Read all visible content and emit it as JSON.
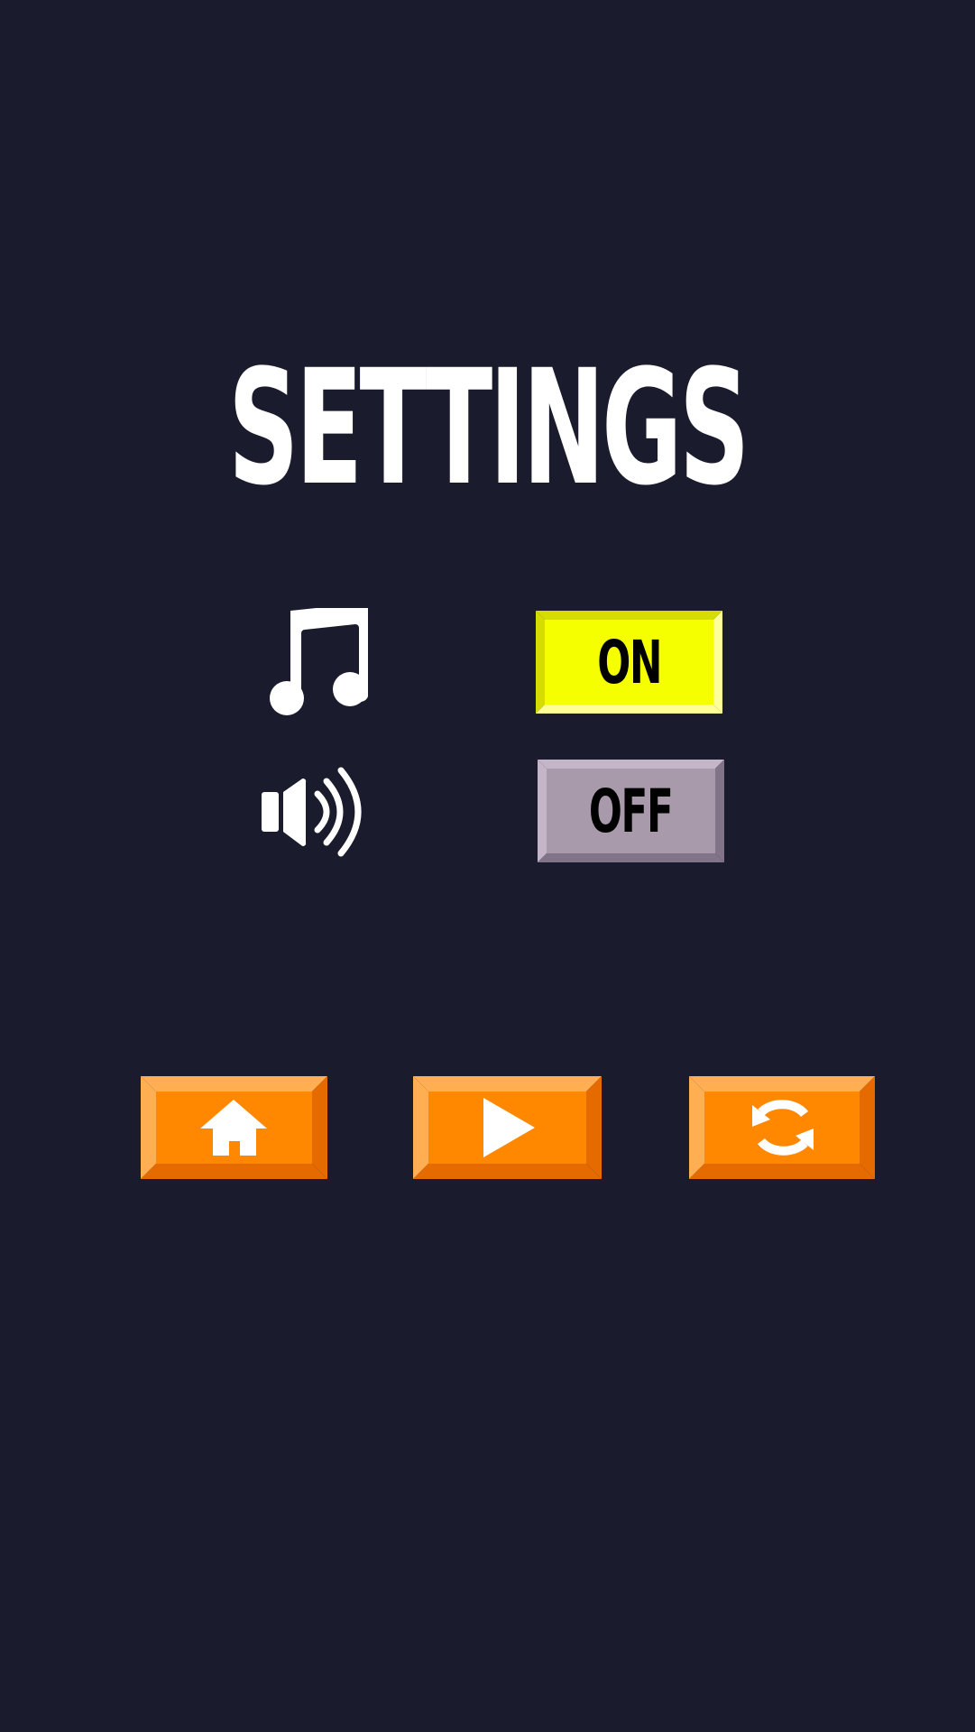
{
  "screen": {
    "title": "SETTINGS"
  },
  "settings": {
    "music": {
      "icon": "music-note-icon",
      "state_label": "ON",
      "colors": {
        "face": "#f5ff00",
        "top": "#d6dc00",
        "bottom": "#ffff99"
      }
    },
    "sound": {
      "icon": "speaker-icon",
      "state_label": "OFF",
      "colors": {
        "face": "#a89aaa",
        "top": "#c4b6c8",
        "bottom": "#827488"
      }
    }
  },
  "nav_buttons": [
    {
      "id": "home",
      "icon": "home-icon"
    },
    {
      "id": "play",
      "icon": "play-icon"
    },
    {
      "id": "restart",
      "icon": "restart-icon"
    }
  ],
  "colors": {
    "background": "#1a1c2e",
    "nav_face": "#ff8800",
    "nav_light": "#ffae52",
    "nav_dark": "#e56a00"
  }
}
